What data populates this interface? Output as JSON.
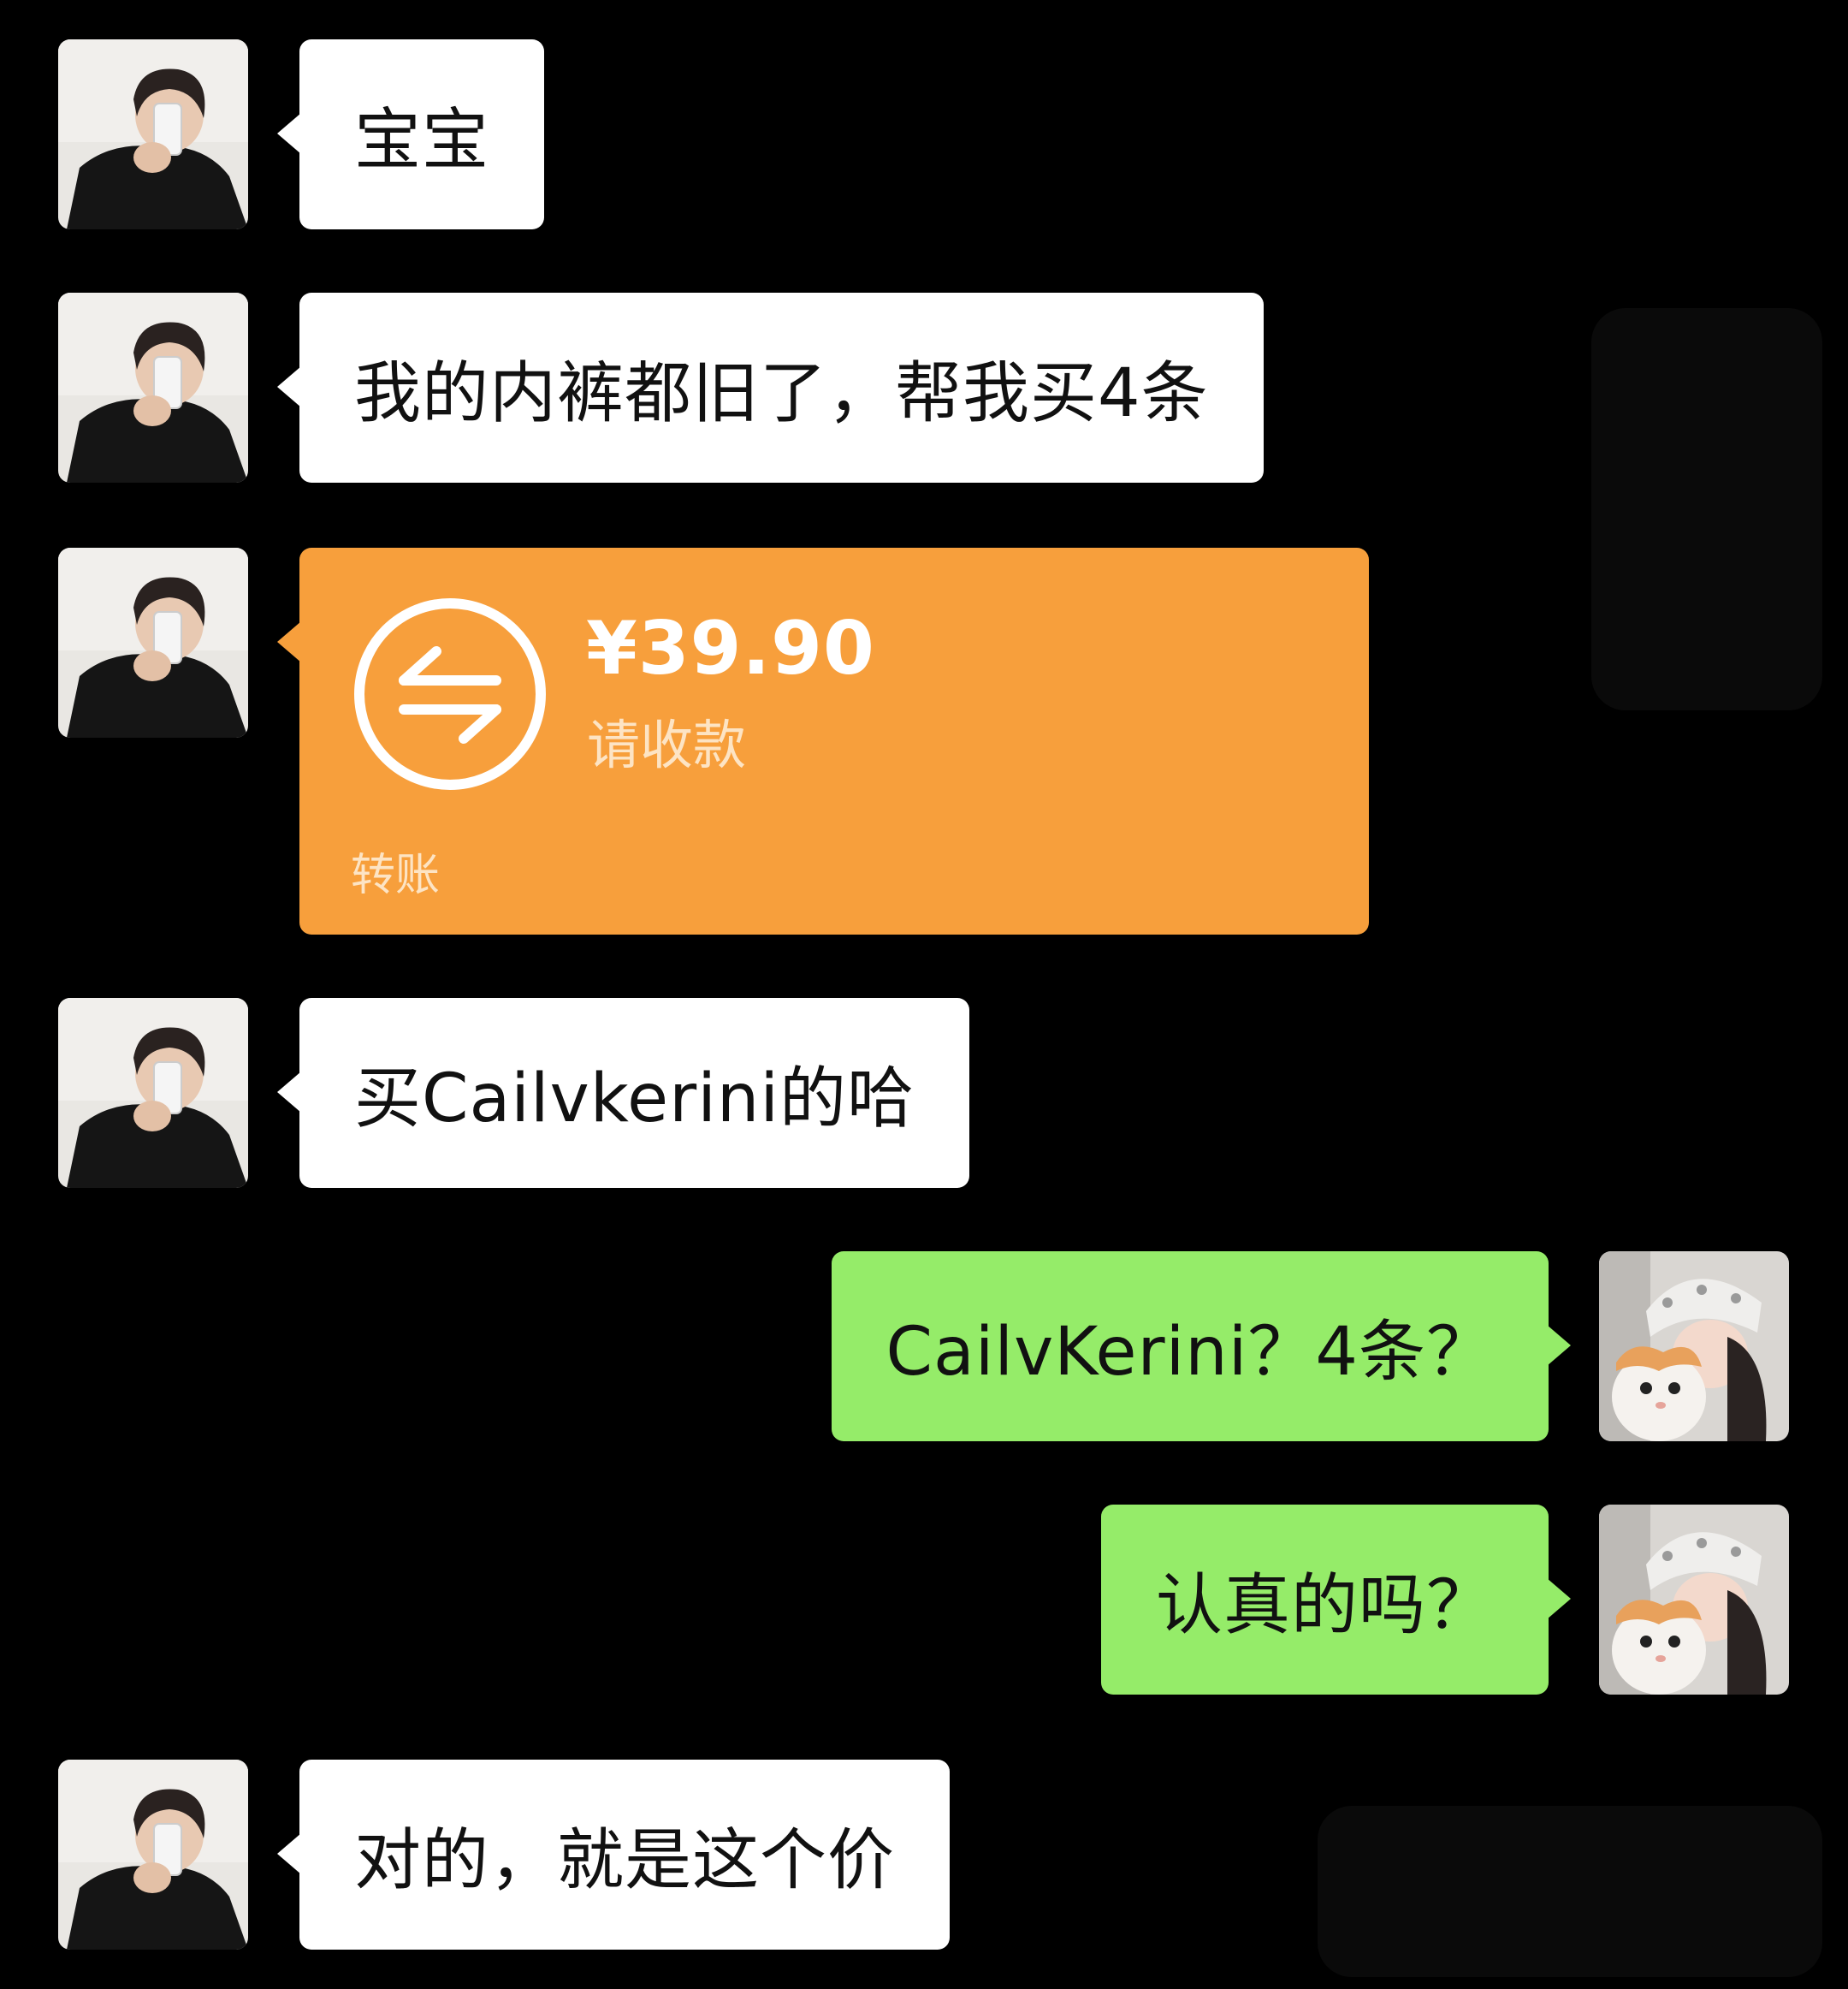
{
  "messages": [
    {
      "side": "left",
      "type": "text",
      "text": "宝宝"
    },
    {
      "side": "left",
      "type": "text",
      "text": "我的内裤都旧了，帮我买4条"
    },
    {
      "side": "left",
      "type": "transfer",
      "amount": "¥39.90",
      "status": "请收款",
      "label": "转账"
    },
    {
      "side": "left",
      "type": "text",
      "text": "买Cailvkerini的哈"
    },
    {
      "side": "right",
      "type": "text",
      "text": "CailvKerini？4条？"
    },
    {
      "side": "right",
      "type": "text",
      "text": "认真的吗？"
    },
    {
      "side": "left",
      "type": "text",
      "text": "对的，就是这个价"
    }
  ],
  "colors": {
    "background": "#000000",
    "incoming_bubble": "#ffffff",
    "outgoing_bubble": "#95ec69",
    "transfer_card": "#f79f3c"
  },
  "icons": {
    "transfer": "transfer-arrows-icon",
    "sender_avatar": "male-avatar-icon",
    "me_avatar": "female-with-cat-avatar-icon"
  }
}
